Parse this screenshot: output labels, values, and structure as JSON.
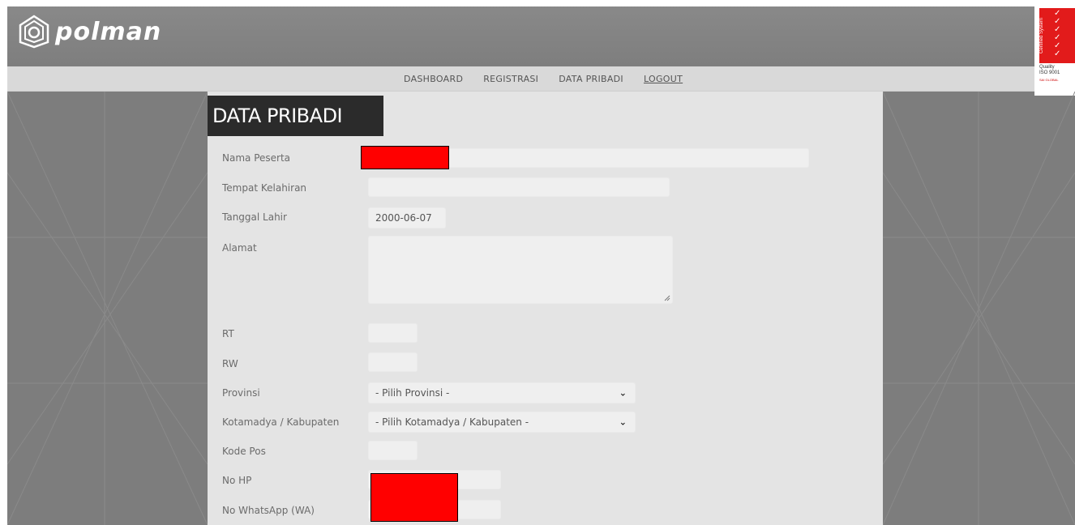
{
  "header": {
    "logo_text": "polman"
  },
  "nav": {
    "items": [
      {
        "label": "DASHBOARD"
      },
      {
        "label": "REGISTRASI"
      },
      {
        "label": "DATA PRIBADI"
      },
      {
        "label": "LOGOUT"
      }
    ]
  },
  "iso_badge": {
    "vertical_text": "Certified System",
    "line1": "Quality",
    "line2": "ISO 9001",
    "brand": "SAI GLOBAL"
  },
  "page": {
    "title": "DATA PRIBADI"
  },
  "form": {
    "nama_peserta": {
      "label": "Nama Peserta",
      "value": ""
    },
    "tempat_kelahiran": {
      "label": "Tempat Kelahiran",
      "value": ""
    },
    "tanggal_lahir": {
      "label": "Tanggal Lahir",
      "value": "2000-06-07"
    },
    "alamat": {
      "label": "Alamat",
      "value": ""
    },
    "rt": {
      "label": "RT",
      "value": ""
    },
    "rw": {
      "label": "RW",
      "value": ""
    },
    "provinsi": {
      "label": "Provinsi",
      "selected": "- Pilih Provinsi -"
    },
    "kota": {
      "label": "Kotamadya / Kabupaten",
      "selected": "- Pilih Kotamadya / Kabupaten -"
    },
    "kode_pos": {
      "label": "Kode Pos",
      "value": ""
    },
    "no_hp": {
      "label": "No HP",
      "value": ""
    },
    "no_wa": {
      "label": "No WhatsApp (WA)",
      "value": ""
    }
  },
  "colors": {
    "header_bg": "#838383",
    "nav_bg": "#d9d9d9",
    "panel_bg": "#e4e4e4",
    "title_bg": "#2b2b2b",
    "redaction": "#ff0000"
  }
}
